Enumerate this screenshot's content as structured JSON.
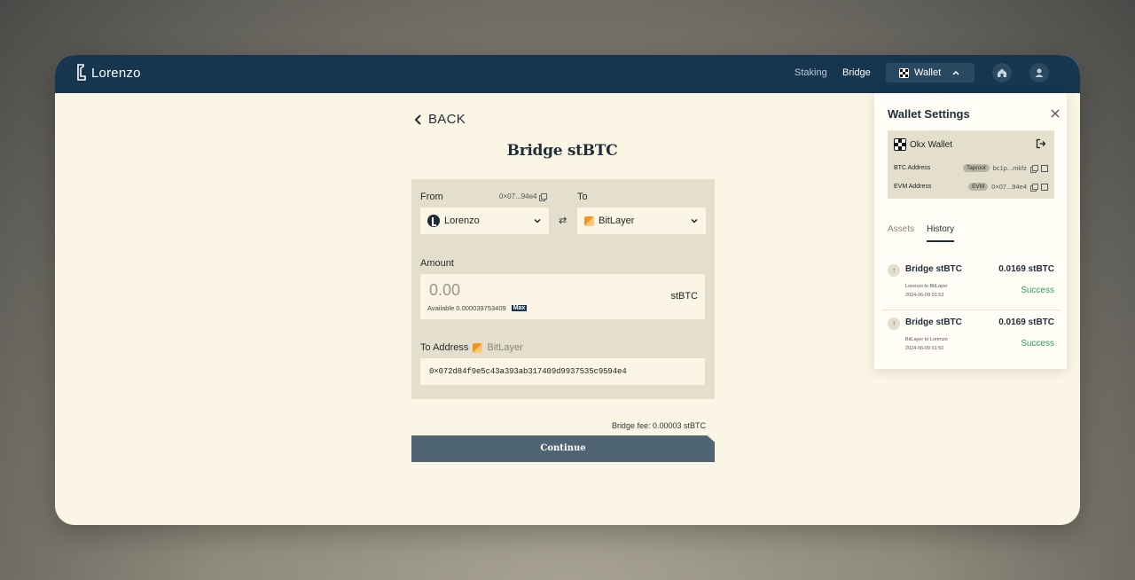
{
  "app": {
    "name": "Lorenzo"
  },
  "nav": {
    "staking": "Staking",
    "bridge": "Bridge",
    "wallet": "Wallet"
  },
  "back": "BACK",
  "page_title": "Bridge stBTC",
  "form": {
    "from_label": "From",
    "from_address": "0×07...94e4",
    "from_network": "Lorenzo",
    "to_label": "To",
    "to_network": "BitLayer",
    "amount_label": "Amount",
    "amount_placeholder": "0.00",
    "available": "Available 0.000039753409",
    "max": "Max",
    "unit": "stBTC",
    "to_address_label": "To Address",
    "to_address_network": "BitLayer",
    "to_address": "0×072d84f9e5c43a393ab317409d9937535c9594e4",
    "fee": "Bridge fee: 0.00003 stBTC",
    "continue": "Continue"
  },
  "wallet_settings": {
    "title": "Wallet Settings",
    "wallet_name": "Okx Wallet",
    "btc_label": "BTC Address",
    "btc_tag": "Taproot",
    "btc_addr": "bc1p...mkfz",
    "evm_label": "EVM Address",
    "evm_tag": "EVM",
    "evm_addr": "0×07...94e4",
    "tabs": [
      "Assets",
      "History"
    ],
    "history": [
      {
        "title": "Bridge stBTC",
        "amount": "0.0169 stBTC",
        "route": "Lorenzo to BitLayer",
        "time": "2024-06-09 01:53",
        "status": "Success"
      },
      {
        "title": "Bridge stBTC",
        "amount": "0.0169 stBTC",
        "route": "BitLayer to Lorenzo",
        "time": "2024-06-09 01:50",
        "status": "Success"
      }
    ]
  },
  "colors": {
    "navy": "#163650",
    "cream": "#fbf5e6",
    "card": "#e3dfcc",
    "success": "#2f9d5c",
    "button": "#4f6574"
  },
  "icons": [
    "lorenzo-logo-icon",
    "okx-icon",
    "chevron-up-icon",
    "home-icon",
    "user-icon",
    "chevron-left-icon",
    "chevron-down-icon",
    "swap-icon",
    "copy-icon",
    "close-icon",
    "logout-icon",
    "external-link-icon",
    "arrow-up-icon"
  ]
}
